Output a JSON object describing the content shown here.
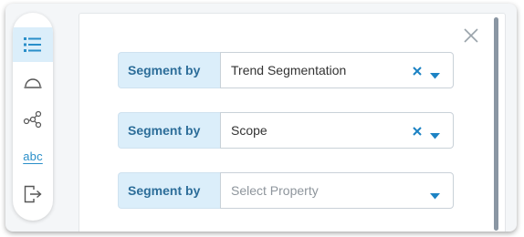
{
  "toolbar": {
    "items": [
      {
        "icon": "list-icon",
        "active": true
      },
      {
        "icon": "gauge-icon",
        "active": false
      },
      {
        "icon": "network-icon",
        "active": false
      },
      {
        "icon": "text-abc-icon",
        "text": "abc",
        "active": false
      },
      {
        "icon": "export-icon",
        "active": false
      }
    ],
    "accent_color": "#2a8fc9",
    "active_background": "#dbeefa"
  },
  "panel": {
    "close_icon": "close-icon",
    "segments": [
      {
        "label": "Segment by",
        "value": "Trend Segmentation",
        "placeholder": "",
        "clearable": true
      },
      {
        "label": "Segment by",
        "value": "Scope",
        "placeholder": "",
        "clearable": true
      },
      {
        "label": "Segment by",
        "value": "",
        "placeholder": "Select Property",
        "clearable": false
      }
    ]
  }
}
